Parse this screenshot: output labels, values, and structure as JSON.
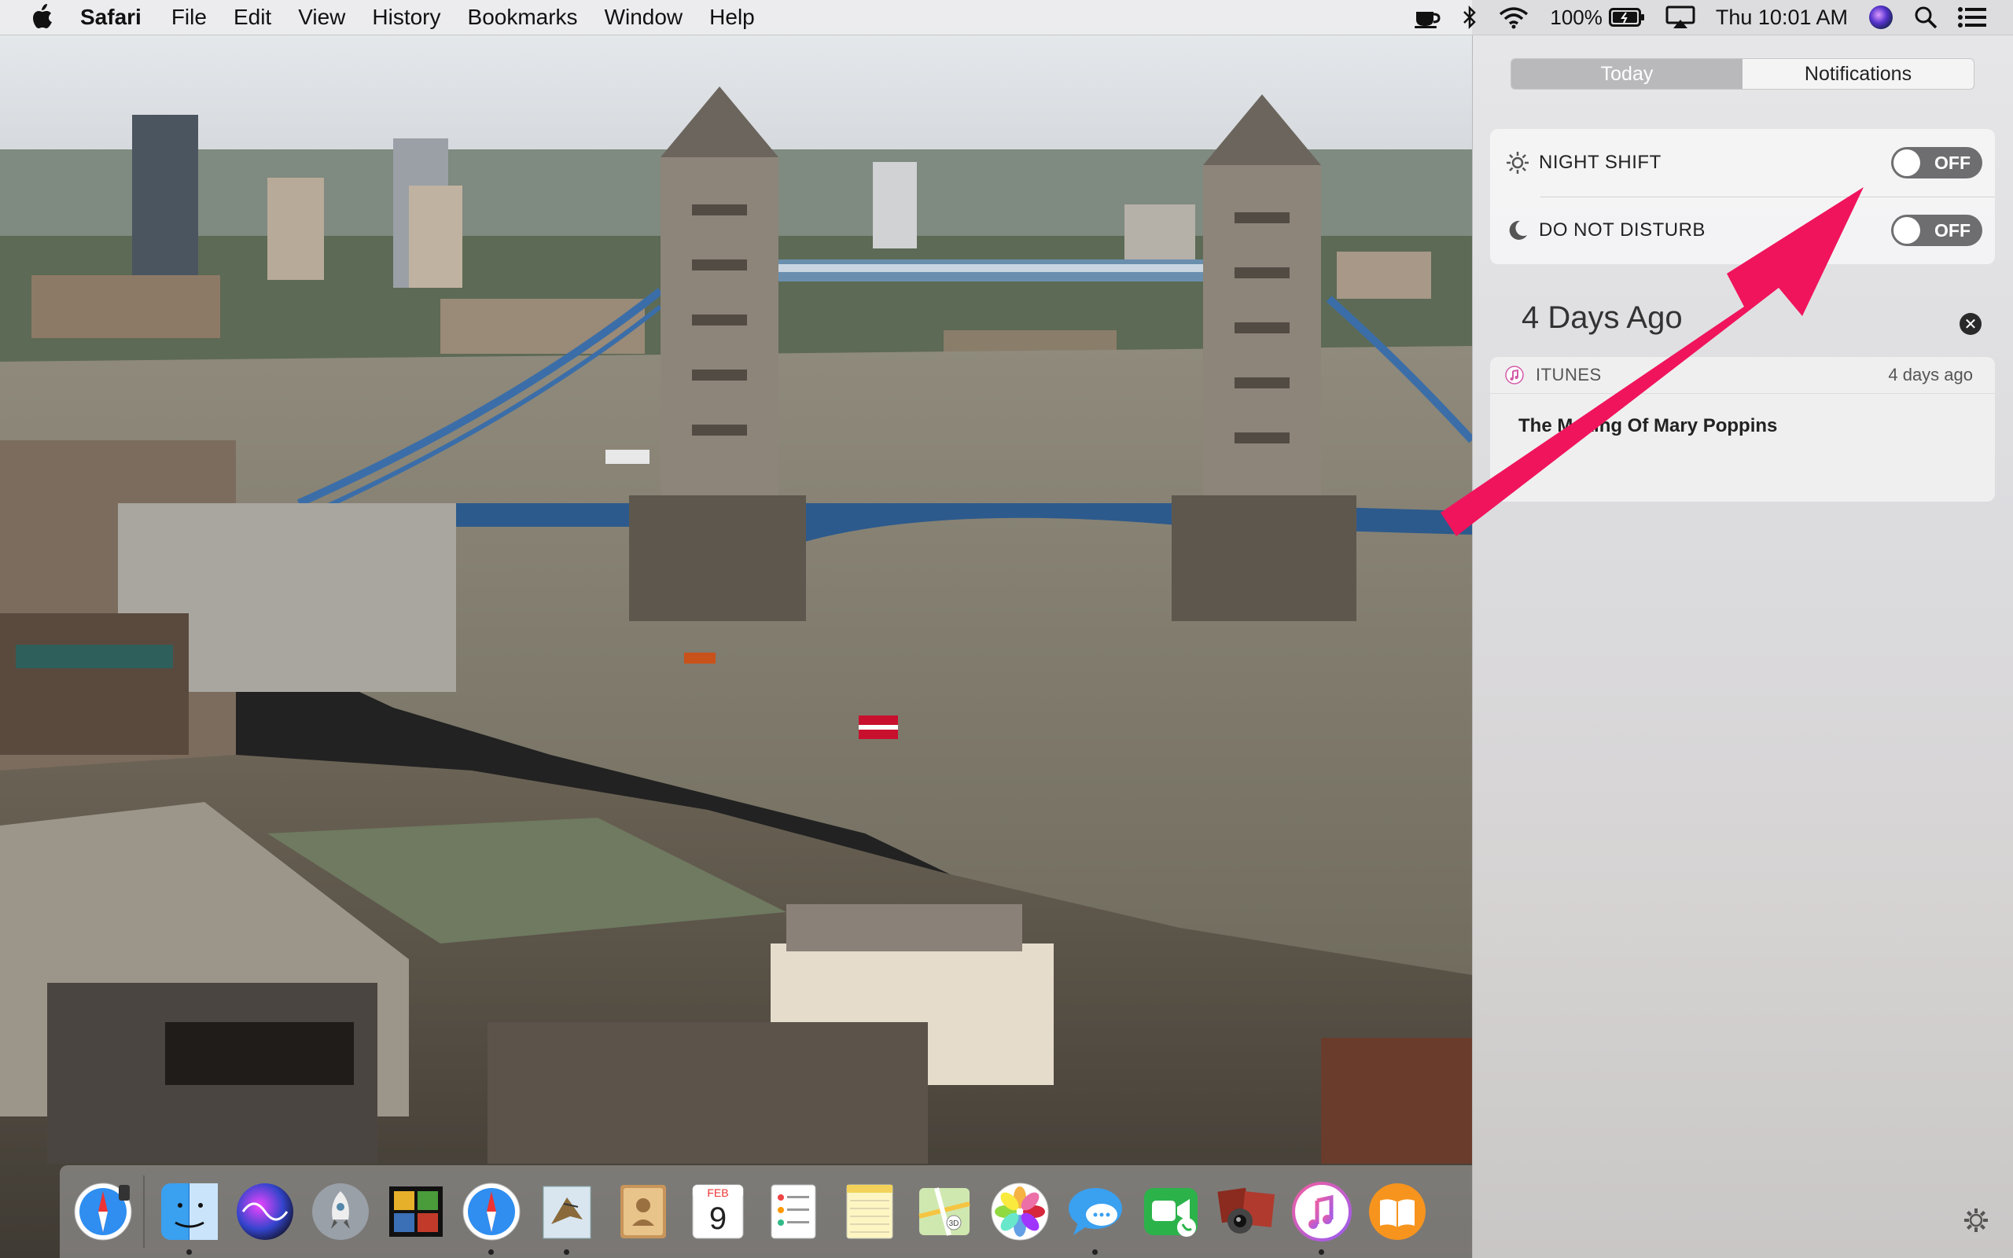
{
  "menubar": {
    "app_name": "Safari",
    "items": [
      "File",
      "Edit",
      "View",
      "History",
      "Bookmarks",
      "Window",
      "Help"
    ],
    "battery": "100%",
    "clock": "Thu 10:01 AM",
    "icons": [
      "apple-icon",
      "coffee-cup-icon",
      "bluetooth-icon",
      "wifi-icon",
      "battery-icon",
      "airplay-icon",
      "siri-icon",
      "spotlight-search-icon",
      "notification-center-icon"
    ]
  },
  "notification_center": {
    "tabs": [
      {
        "label": "Today",
        "active": true
      },
      {
        "label": "Notifications",
        "active": false
      }
    ],
    "toggles": [
      {
        "label": "NIGHT SHIFT",
        "state": "OFF",
        "icon": "sun-icon"
      },
      {
        "label": "DO NOT DISTURB",
        "state": "OFF",
        "icon": "moon-icon"
      }
    ],
    "section_title": "4 Days Ago",
    "notification": {
      "app": "ITUNES",
      "time": "4 days ago",
      "body": "The Making Of Mary Poppins",
      "icon": "music-note-icon"
    },
    "settings_icon": "gear-icon"
  },
  "annotation": {
    "color": "#f0145c",
    "shape": "arrow"
  },
  "dock": {
    "items": [
      {
        "name": "safari-technology-preview",
        "running": false
      },
      {
        "name": "finder",
        "running": true
      },
      {
        "name": "siri",
        "running": false
      },
      {
        "name": "launchpad",
        "running": false
      },
      {
        "name": "photo-booth",
        "running": false
      },
      {
        "name": "safari",
        "running": true
      },
      {
        "name": "mail",
        "running": true
      },
      {
        "name": "contacts",
        "running": false
      },
      {
        "name": "calendar",
        "running": false,
        "month": "FEB",
        "day": "9"
      },
      {
        "name": "reminders",
        "running": false
      },
      {
        "name": "notes",
        "running": false
      },
      {
        "name": "maps",
        "running": false
      },
      {
        "name": "photos",
        "running": false
      },
      {
        "name": "messages",
        "running": true
      },
      {
        "name": "facetime",
        "running": false
      },
      {
        "name": "photo-gallery",
        "running": false
      },
      {
        "name": "itunes",
        "running": true
      },
      {
        "name": "ibooks",
        "running": false
      }
    ]
  }
}
